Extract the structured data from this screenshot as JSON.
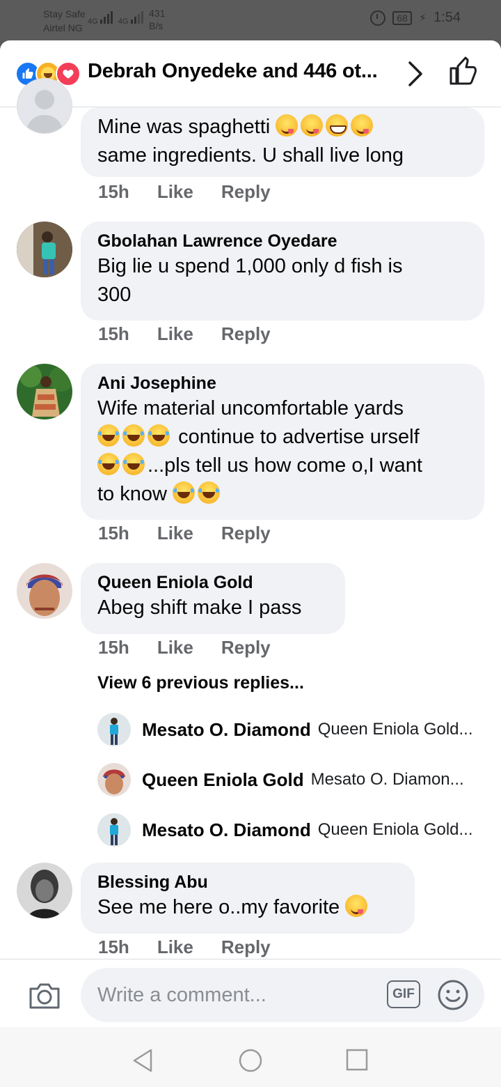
{
  "status_bar": {
    "line1": "Stay Safe",
    "line2": "Airtel NG",
    "net1": "4G",
    "net2": "4G",
    "speed_value": "431",
    "speed_unit": "B/s",
    "battery": "68",
    "time": "1:54"
  },
  "header": {
    "reactions": [
      "like",
      "haha",
      "love"
    ],
    "title": "Debrah Onyedeke and 446 ot...",
    "chevron_icon": "chevron-right-icon",
    "like_icon": "thumbs-up-icon"
  },
  "comments": [
    {
      "author": "",
      "text_lines": [
        "Mine was spaghetti",
        "same ingredients. U shall live long"
      ],
      "time": "15h",
      "like": "Like",
      "reply": "Reply"
    },
    {
      "author": "Gbolahan Lawrence Oyedare",
      "text_lines": [
        "Big lie u spend 1,000 only d fish is",
        "300"
      ],
      "time": "15h",
      "like": "Like",
      "reply": "Reply"
    },
    {
      "author": "Ani Josephine",
      "text_lines": [
        "Wife material uncomfortable yards",
        "continue to advertise urself",
        "...pls tell us how come o,I want",
        "to know"
      ],
      "time": "15h",
      "like": "Like",
      "reply": "Reply"
    },
    {
      "author": "Queen Eniola Gold",
      "text_lines": [
        "Abeg shift make I pass"
      ],
      "time": "15h",
      "like": "Like",
      "reply": "Reply",
      "view_previous": "View 6 previous replies...",
      "replies": [
        {
          "name": "Mesato O. Diamond",
          "text": "Queen Eniola Gold..."
        },
        {
          "name": "Queen Eniola Gold",
          "text": "Mesato O. Diamon..."
        },
        {
          "name": "Mesato O. Diamond",
          "text": "Queen Eniola Gold..."
        }
      ]
    },
    {
      "author": "Blessing Abu",
      "text_lines": [
        "See me here o..my favorite"
      ],
      "time": "15h",
      "like": "Like",
      "reply": "Reply"
    }
  ],
  "composer": {
    "placeholder": "Write a comment...",
    "gif_label": "GIF"
  },
  "colors": {
    "facebook_blue": "#1877f2",
    "bubble_bg": "#f0f2f5",
    "meta_gray": "#65676b"
  }
}
